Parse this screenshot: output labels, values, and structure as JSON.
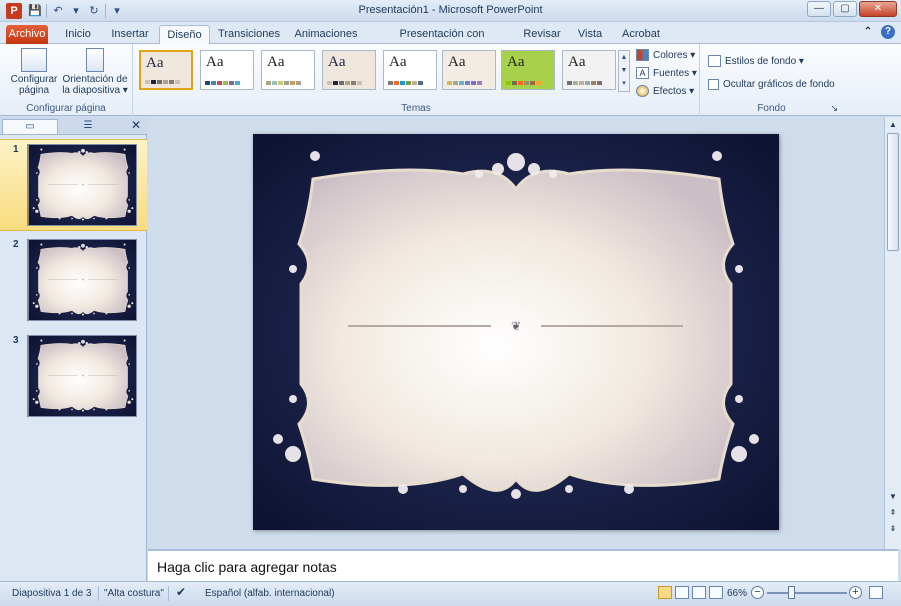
{
  "window": {
    "title": "Presentación1  -  Microsoft PowerPoint",
    "app_icon": "P",
    "min": "—",
    "max": "▢",
    "close": "✕"
  },
  "qat": {
    "save": "💾",
    "undo": "↶",
    "undo_drop": "▾",
    "redo": "↻",
    "customize": "▾"
  },
  "tabs": [
    {
      "label": "Archivo"
    },
    {
      "label": "Inicio"
    },
    {
      "label": "Insertar"
    },
    {
      "label": "Diseño"
    },
    {
      "label": "Transiciones"
    },
    {
      "label": "Animaciones"
    },
    {
      "label": "Presentación con diapositivas"
    },
    {
      "label": "Revisar"
    },
    {
      "label": "Vista"
    },
    {
      "label": "Acrobat"
    }
  ],
  "ribbon": {
    "page_setup": {
      "config_label": "Configurar página",
      "orientation_label": "Orientación de la diapositiva ▾",
      "group_label": "Configurar página"
    },
    "themes": {
      "group_label": "Temas",
      "sample_text": "Aa",
      "items": [
        {
          "name": "theme-current",
          "bg": "#efe6dc",
          "accent": "#1b2340",
          "colors": [
            "#cfc2b4",
            "#1b2340",
            "#6e6e6e",
            "#b0a08e",
            "#8a7d6e",
            "#ccbfb2"
          ]
        },
        {
          "name": "theme-office",
          "bg": "#ffffff",
          "accent": "#ffffff",
          "colors": [
            "#1f497d",
            "#4f81bd",
            "#c0504d",
            "#9bbb59",
            "#8064a2",
            "#4bacc6"
          ]
        },
        {
          "name": "theme-adjacency",
          "bg": "#ffffff",
          "accent": "#222222",
          "colors": [
            "#a9a57c",
            "#9cbebd",
            "#d2cb6c",
            "#95a39d",
            "#c89f5d",
            "#b1a089"
          ]
        },
        {
          "name": "theme-alta-costura-dark",
          "bg": "#efe6dc",
          "accent": "#1b2340",
          "colors": [
            "#cfc2b4",
            "#1b2340",
            "#6e6e6e",
            "#b0a08e",
            "#8a7d6e",
            "#ccbfb2"
          ]
        },
        {
          "name": "theme-angles",
          "bg": "#ffffff",
          "accent": "#3b88c4",
          "colors": [
            "#797b7e",
            "#f96a1b",
            "#08a1d9",
            "#7c984a",
            "#c2ad8d",
            "#506e94"
          ]
        },
        {
          "name": "theme-apex",
          "bg": "#f3ece5",
          "accent": "#c46b3a",
          "colors": [
            "#ceb966",
            "#9cb084",
            "#6bb1c9",
            "#6585cf",
            "#7e6bc9",
            "#a379bb"
          ]
        },
        {
          "name": "theme-austin",
          "bg": "#a7d04b",
          "accent": "#6e4e2c",
          "colors": [
            "#94c600",
            "#71685a",
            "#ff6700",
            "#909465",
            "#956b43",
            "#fea022"
          ]
        },
        {
          "name": "theme-black-tie",
          "bg": "#f2f2f2",
          "accent": "#5f8b70",
          "colors": [
            "#6f6f74",
            "#a7b789",
            "#beae98",
            "#92a9b9",
            "#9c8265",
            "#8d6974"
          ]
        }
      ],
      "scroll_up": "▲",
      "scroll_down": "▼",
      "more": "▾"
    },
    "theme_options": {
      "colors": "Colores ▾",
      "fonts": "Fuentes ▾",
      "effects": "Efectos ▾"
    },
    "background": {
      "styles": "Estilos de fondo ▾",
      "hide_graphics": "Ocultar gráficos de fondo",
      "group_label": "Fondo",
      "launcher": "↘"
    }
  },
  "left_panel": {
    "tab_slides_icon": "▭",
    "tab_outline_icon": "☰",
    "close": "✕",
    "slides": [
      {
        "num": "1"
      },
      {
        "num": "2"
      },
      {
        "num": "3"
      }
    ]
  },
  "notes": {
    "placeholder": "Haga clic para agregar notas"
  },
  "status": {
    "slide_info": "Diapositiva 1 de 3",
    "theme_name": "\"Alta costura\"",
    "language": "Español (alfab. internacional)",
    "zoom": "66%"
  },
  "scroll": {
    "up": "▲",
    "down": "▼",
    "prev": "⇞",
    "next": "⇟"
  },
  "colors": {
    "slide_dark": "#141a3a",
    "frame_light": "#f4ece4",
    "file_tab": "#d24a22"
  }
}
